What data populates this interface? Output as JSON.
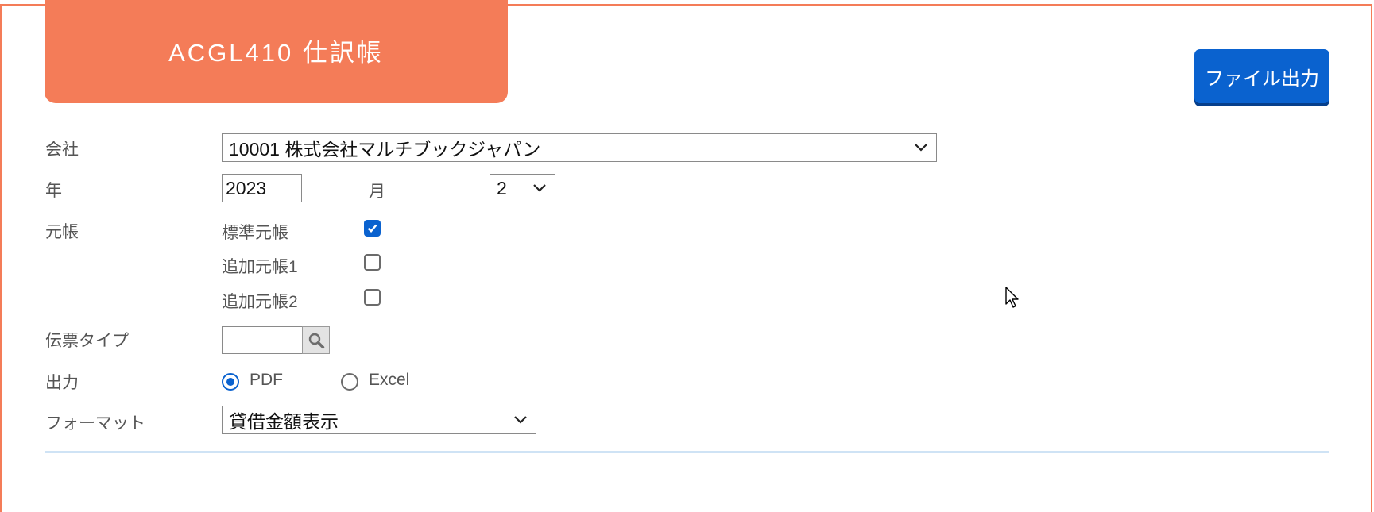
{
  "header": {
    "title": "ACGL410 仕訳帳",
    "export_button": "ファイル出力"
  },
  "form": {
    "company": {
      "label": "会社",
      "value": "10001 株式会社マルチブックジャパン"
    },
    "year": {
      "label": "年",
      "value": "2023"
    },
    "month": {
      "label": "月",
      "value": "2"
    },
    "ledger": {
      "label": "元帳",
      "options": [
        {
          "label": "標準元帳",
          "checked": true
        },
        {
          "label": "追加元帳1",
          "checked": false
        },
        {
          "label": "追加元帳2",
          "checked": false
        }
      ]
    },
    "voucher_type": {
      "label": "伝票タイプ",
      "value": ""
    },
    "output": {
      "label": "出力",
      "options": [
        {
          "label": "PDF",
          "selected": true
        },
        {
          "label": "Excel",
          "selected": false
        }
      ]
    },
    "format": {
      "label": "フォーマット",
      "value": "貸借金額表示"
    }
  },
  "colors": {
    "accent": "#f47c58",
    "primary_button": "#0a62cf",
    "divider": "#cfe3f5"
  },
  "icons": {
    "search": "search-icon",
    "dropdown": "chevron-down-icon",
    "cursor": "mouse-pointer-icon"
  }
}
